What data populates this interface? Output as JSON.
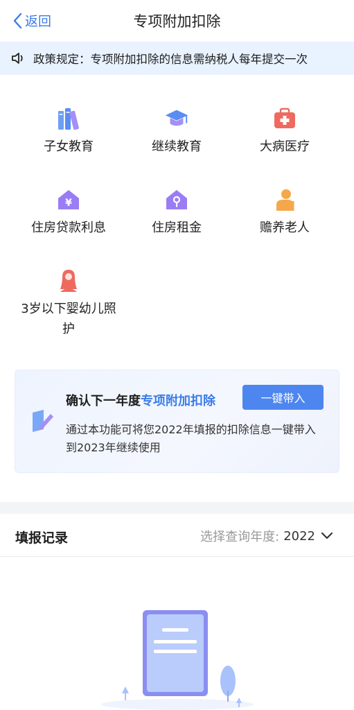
{
  "nav": {
    "back_label": "返回",
    "title": "专项附加扣除"
  },
  "notice": {
    "text": "政策规定：专项附加扣除的信息需纳税人每年提交一次"
  },
  "categories": [
    {
      "label": "子女教育",
      "icon": "books-icon"
    },
    {
      "label": "继续教育",
      "icon": "graduation-cap-icon"
    },
    {
      "label": "大病医疗",
      "icon": "medical-kit-icon"
    },
    {
      "label": "住房贷款利息",
      "icon": "house-yuan-icon"
    },
    {
      "label": "住房租金",
      "icon": "house-key-icon"
    },
    {
      "label": "赡养老人",
      "icon": "elderly-person-icon"
    },
    {
      "label": "3岁以下婴幼儿照护",
      "icon": "mother-baby-icon"
    }
  ],
  "card": {
    "title_prefix": "确认下一年度",
    "title_highlight": "专项附加扣除",
    "button_label": "一键带入",
    "description": "通过本功能可将您2022年填报的扣除信息一键带入到2023年继续使用"
  },
  "records": {
    "title": "填报记录",
    "year_label": "选择查询年度:",
    "year_value": "2022"
  },
  "colors": {
    "accent": "#3b7ce8",
    "button": "#4e86f0",
    "notice_bg": "#e9f2ff"
  }
}
